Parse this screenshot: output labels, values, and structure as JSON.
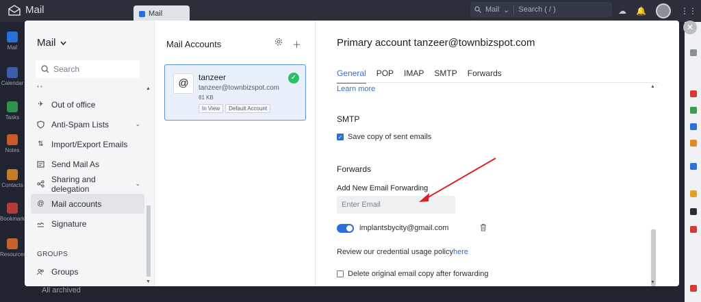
{
  "app": {
    "title": "Mail",
    "tab_label": "Mail",
    "search_scope": "Mail",
    "search_placeholder": "Search ( / )",
    "rail": [
      "Mail",
      "Calendar",
      "Tasks",
      "Notes",
      "Contacts",
      "Bookmarks",
      "Resources"
    ],
    "bottom_text": "All archived"
  },
  "nav": {
    "title": "Mail",
    "search_placeholder": "Search",
    "items": [
      {
        "label": "Out of office",
        "icon": "plane-icon"
      },
      {
        "label": "Anti-Spam Lists",
        "icon": "shield-icon",
        "expandable": true
      },
      {
        "label": "Import/Export Emails",
        "icon": "import-export-icon"
      },
      {
        "label": "Send Mail As",
        "icon": "send-as-icon"
      },
      {
        "label": "Sharing and delegation",
        "icon": "share-icon",
        "expandable": true
      },
      {
        "label": "Mail accounts",
        "icon": "at-icon",
        "active": true
      },
      {
        "label": "Signature",
        "icon": "signature-icon"
      }
    ],
    "groups_heading": "GROUPS",
    "groups_item": "Groups"
  },
  "accounts": {
    "title": "Mail Accounts",
    "card": {
      "name": "tanzeer",
      "email": "tanzeer@townbizspot.com",
      "size": "81 KB",
      "badges": [
        "In View",
        "Default Account"
      ]
    }
  },
  "detail": {
    "title": "Primary account tanzeer@townbizspot.com",
    "tabs": [
      "General",
      "POP",
      "IMAP",
      "SMTP",
      "Forwards"
    ],
    "active_tab": "General",
    "learn_more": "Learn more",
    "smtp_heading": "SMTP",
    "smtp_option": "Save copy of sent emails",
    "smtp_option_checked": true,
    "forwards_heading": "Forwards",
    "add_forward_label": "Add New Email Forwarding",
    "email_placeholder": "Enter Email",
    "forward_address": "implantsbycity@gmail.com",
    "forward_enabled": true,
    "policy_text": "Review our credential usage policy",
    "policy_link": "here",
    "delete_copy_option": "Delete original email copy after forwarding",
    "delete_copy_checked": false
  },
  "colors": {
    "accent": "#2d6fd8",
    "success": "#2dbf6a",
    "annotation": "#e02020"
  }
}
